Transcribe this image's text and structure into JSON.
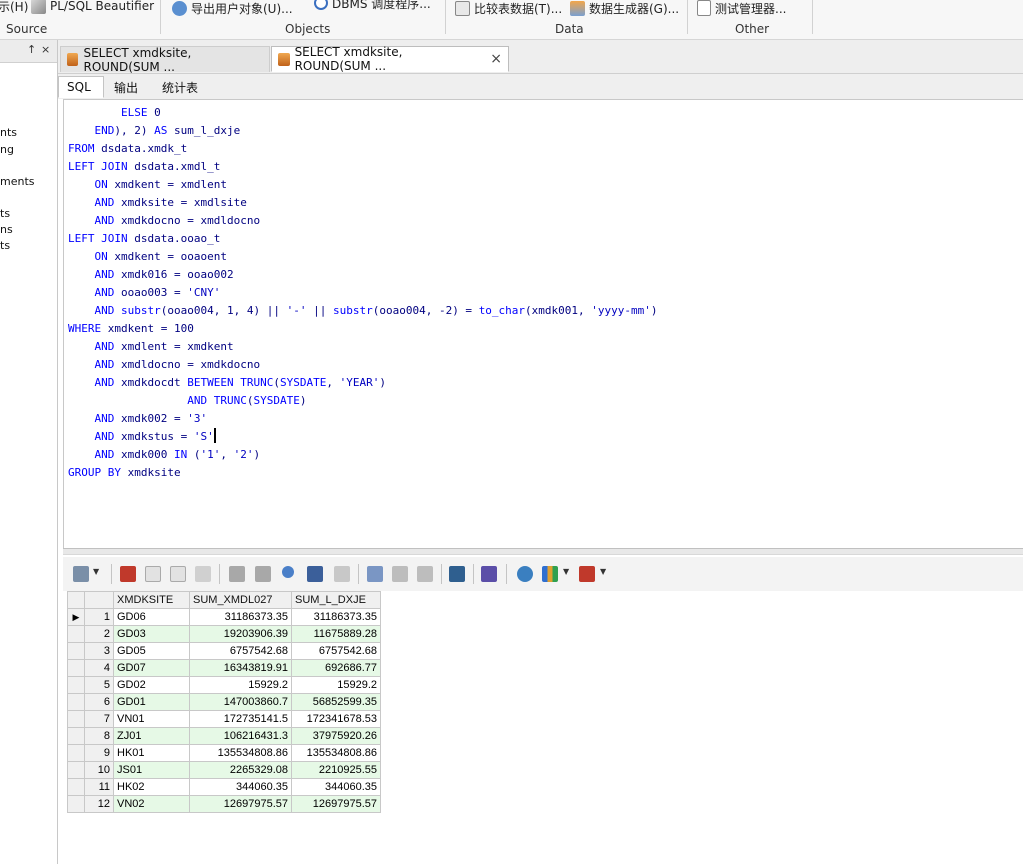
{
  "ribbon": {
    "items": [
      {
        "label": "示(H)",
        "icon": "help-icon"
      },
      {
        "label": "PL/SQL Beautifier",
        "icon": "beautifier-icon"
      },
      {
        "label": "导出用户对象(U)...",
        "icon": "export-user-objects-icon"
      },
      {
        "label": "DBMS 调度程序...",
        "icon": "dbms-scheduler-icon"
      },
      {
        "label": "比较表数据(T)...",
        "icon": "compare-table-data-icon"
      },
      {
        "label": "数据生成器(G)...",
        "icon": "data-generator-icon"
      },
      {
        "label": "测试管理器...",
        "icon": "test-manager-icon"
      }
    ],
    "groups": [
      "Source",
      "Objects",
      "Data",
      "Other"
    ]
  },
  "left_panel": {
    "pin": "↑",
    "close": "×",
    "items": [
      "nts",
      "ng",
      "ments",
      "ts",
      "ns",
      "ts"
    ]
  },
  "doc_tabs": [
    {
      "label": "SELECT xmdksite, ROUND(SUM ...",
      "active": false
    },
    {
      "label": "SELECT xmdksite, ROUND(SUM ...",
      "active": true,
      "close": "×"
    }
  ],
  "sub_tabs": [
    "SQL",
    "输出",
    "统计表"
  ],
  "sql_lines": [
    "        ELSE 0",
    "    END), 2) AS sum_l_dxje",
    "FROM dsdata.xmdk_t",
    "LEFT JOIN dsdata.xmdl_t",
    "    ON xmdkent = xmdlent",
    "    AND xmdksite = xmdlsite",
    "    AND xmdkdocno = xmdldocno",
    "LEFT JOIN dsdata.ooao_t",
    "    ON xmdkent = ooaoent",
    "    AND xmdk016 = ooao002",
    "    AND ooao003 = 'CNY'",
    "    AND substr(ooao004, 1, 4) || '-' || substr(ooao004, -2) = to_char(xmdk001, 'yyyy-mm')",
    "WHERE xmdkent = 100",
    "    AND xmdlent = xmdkent",
    "    AND xmdldocno = xmdkdocno",
    "    AND xmdkdocdt BETWEEN TRUNC(SYSDATE, 'YEAR')",
    "                  AND TRUNC(SYSDATE)",
    "    AND xmdk002 = '3'",
    "    AND xmdkstus = 'S'",
    "    AND xmdk000 IN ('1', '2')",
    "GROUP BY xmdksite"
  ],
  "toolbar_icons": [
    "grid-options-icon",
    "lock-icon",
    "insert-record-icon",
    "delete-record-icon",
    "post-changes-icon",
    "fetch-next-icon",
    "fetch-last-icon",
    "refresh-icon",
    "query-by-example-icon",
    "clear-record-icon",
    "export-icon",
    "previous-record-icon",
    "next-record-icon",
    "linked-query-icon",
    "save-icon",
    "connection-icon",
    "chart-icon",
    "table-view-icon"
  ],
  "result": {
    "columns": [
      "XMDKSITE",
      "SUM_XMDL027",
      "SUM_L_DXJE"
    ],
    "rows": [
      [
        "1",
        "GD06",
        "31186373.35",
        "31186373.35"
      ],
      [
        "2",
        "GD03",
        "19203906.39",
        "11675889.28"
      ],
      [
        "3",
        "GD05",
        "6757542.68",
        "6757542.68"
      ],
      [
        "4",
        "GD07",
        "16343819.91",
        "692686.77"
      ],
      [
        "5",
        "GD02",
        "15929.2",
        "15929.2"
      ],
      [
        "6",
        "GD01",
        "147003860.7",
        "56852599.35"
      ],
      [
        "7",
        "VN01",
        "172735141.5",
        "172341678.53"
      ],
      [
        "8",
        "ZJ01",
        "106216431.3",
        "37975920.26"
      ],
      [
        "9",
        "HK01",
        "135534808.86",
        "135534808.86"
      ],
      [
        "10",
        "JS01",
        "2265329.08",
        "2210925.55"
      ],
      [
        "11",
        "HK02",
        "344060.35",
        "344060.35"
      ],
      [
        "12",
        "VN02",
        "12697975.57",
        "12697975.57"
      ]
    ]
  },
  "colors": {
    "keyword": "#0000ff",
    "identifier": "#000080",
    "row_alt": "#e6f9e6"
  }
}
